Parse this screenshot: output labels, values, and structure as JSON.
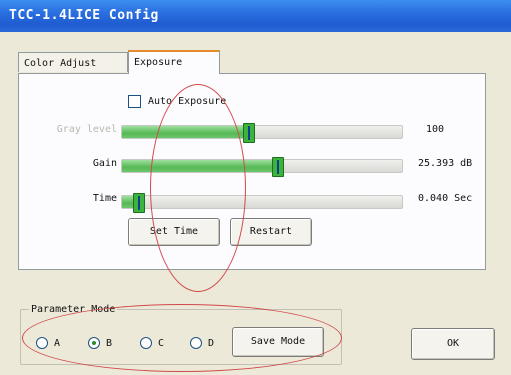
{
  "window": {
    "title": "TCC-1.4LICE Config"
  },
  "tabs": [
    {
      "label": "Color Adjust",
      "active": false
    },
    {
      "label": "Exposure",
      "active": true
    }
  ],
  "exposure": {
    "auto_exposure": {
      "label": "Auto Exposure",
      "checked": false
    },
    "sliders": [
      {
        "label": "Gray level",
        "value_text": "100",
        "enabled": false,
        "level": 0.45
      },
      {
        "label": "Gain",
        "value_text": "25.393 dB",
        "enabled": true,
        "level": 0.56
      },
      {
        "label": "Time",
        "value_text": "0.040 Sec",
        "enabled": true,
        "level": 0.04
      }
    ],
    "buttons": {
      "set_time": "Set Time",
      "restart": "Restart"
    }
  },
  "parameter_mode": {
    "legend": "Parameter Mode",
    "options": [
      {
        "label": "A",
        "checked": false
      },
      {
        "label": "B",
        "checked": true
      },
      {
        "label": "C",
        "checked": false
      },
      {
        "label": "D",
        "checked": false
      }
    ],
    "save_label": "Save Mode"
  },
  "ok_label": "OK",
  "colors": {
    "titlebar": "#2a6fe0",
    "slider_fill": "#56b956",
    "thumb": "#3cb33c",
    "annotation": "#d04a4a"
  }
}
